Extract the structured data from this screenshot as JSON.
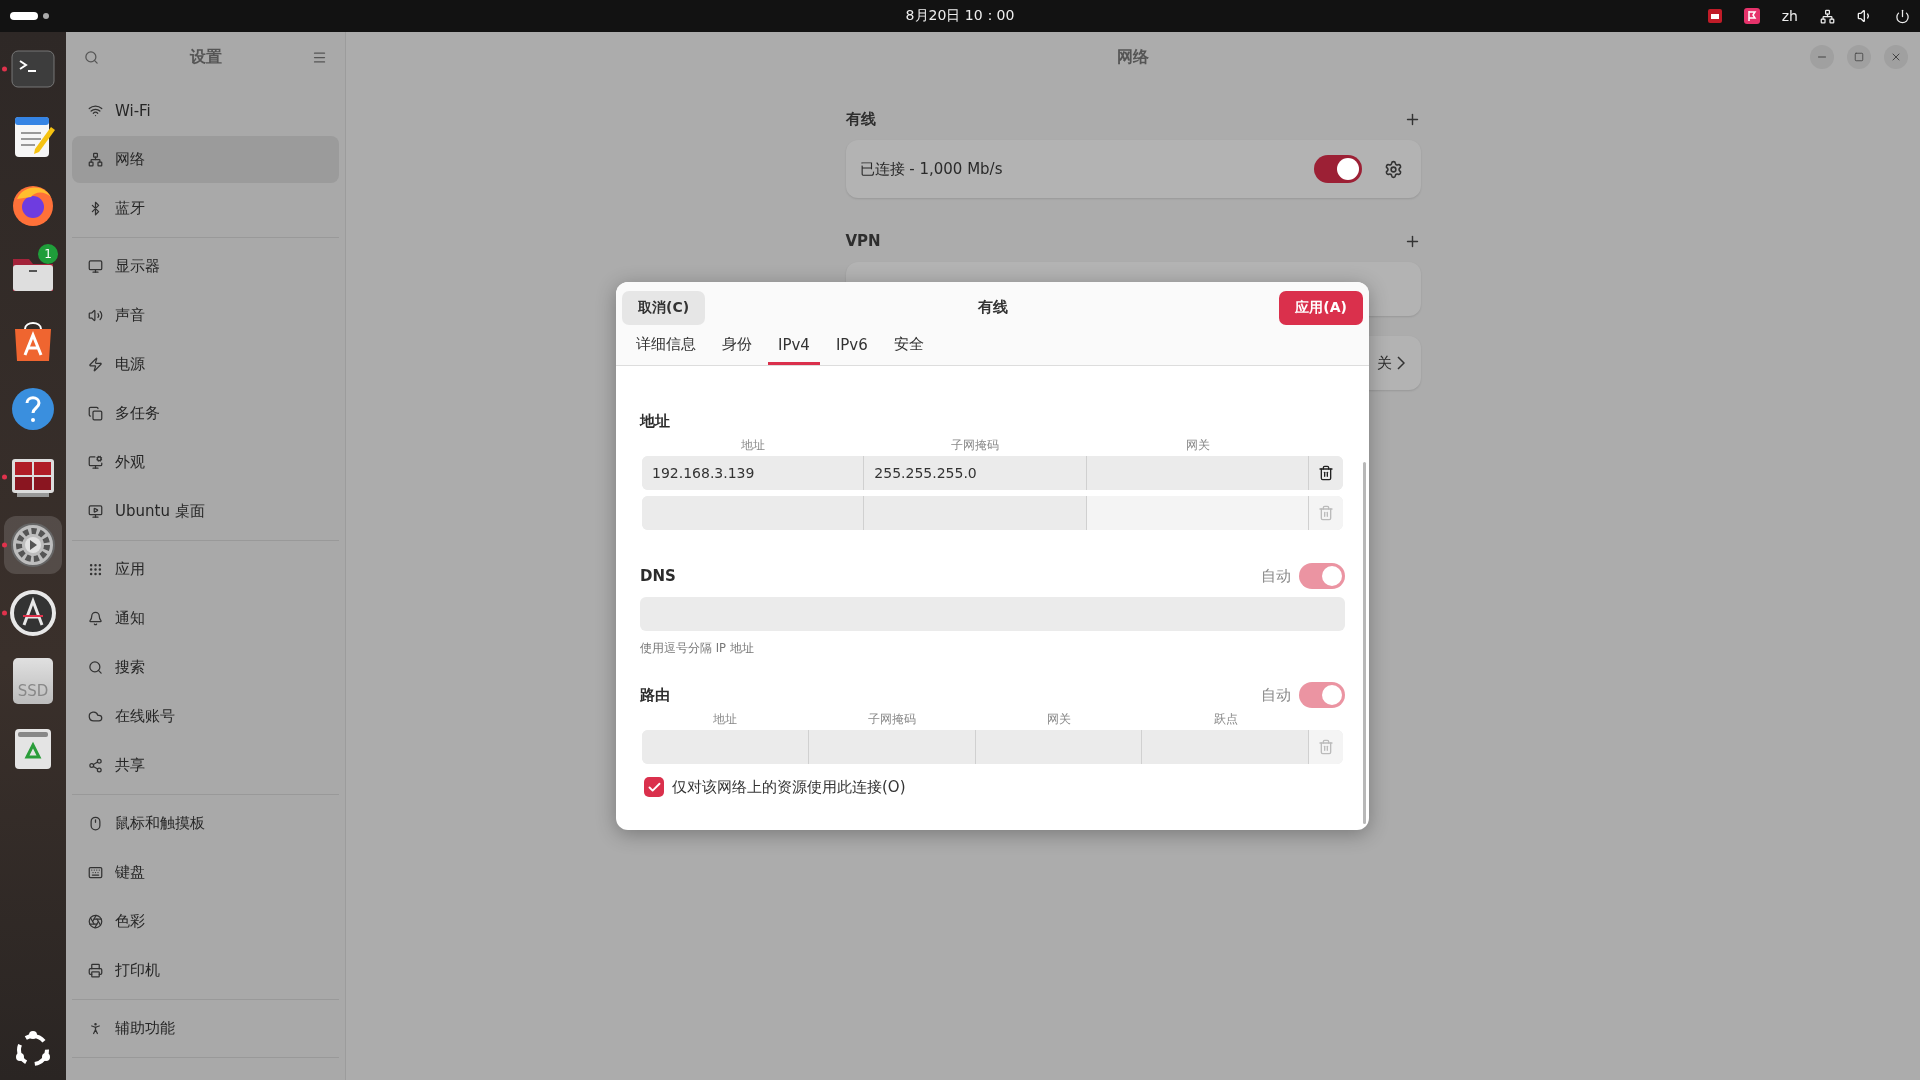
{
  "top_bar": {
    "clock": "8月20日 10：00",
    "input_method": "zh"
  },
  "dock": {
    "items": [
      {
        "kind": "terminal",
        "running": true,
        "selected": false
      },
      {
        "kind": "editor",
        "running": false,
        "selected": false
      },
      {
        "kind": "browser",
        "running": false,
        "selected": false
      },
      {
        "kind": "files",
        "running": false,
        "selected": false,
        "badge": "1"
      },
      {
        "kind": "store",
        "running": false,
        "selected": false
      },
      {
        "kind": "help",
        "running": false,
        "selected": false
      },
      {
        "kind": "grid",
        "running": true,
        "selected": false
      },
      {
        "kind": "settings",
        "running": true,
        "selected": true
      },
      {
        "kind": "updater",
        "running": true,
        "selected": false
      },
      {
        "kind": "drive",
        "running": false,
        "selected": false,
        "label": "SSD"
      },
      {
        "kind": "trash",
        "running": false,
        "selected": false
      }
    ]
  },
  "sidebar": {
    "title": "设置",
    "groups": [
      {
        "items": [
          {
            "label": "Wi-Fi",
            "kind": "wifi",
            "selected": false
          },
          {
            "label": "网络",
            "kind": "network",
            "selected": true
          },
          {
            "label": "蓝牙",
            "kind": "bluetooth",
            "selected": false
          }
        ]
      },
      {
        "items": [
          {
            "label": "显示器",
            "kind": "display",
            "selected": false
          },
          {
            "label": "声音",
            "kind": "sound",
            "selected": false
          },
          {
            "label": "电源",
            "kind": "power",
            "selected": false
          },
          {
            "label": "多任务",
            "kind": "multitask",
            "selected": false
          },
          {
            "label": "外观",
            "kind": "appearance",
            "selected": false
          },
          {
            "label": "Ubuntu 桌面",
            "kind": "desktop",
            "selected": false
          }
        ]
      },
      {
        "items": [
          {
            "label": "应用",
            "kind": "apps",
            "selected": false
          },
          {
            "label": "通知",
            "kind": "bell",
            "selected": false
          },
          {
            "label": "搜索",
            "kind": "search",
            "selected": false
          },
          {
            "label": "在线账号",
            "kind": "cloud",
            "selected": false
          },
          {
            "label": "共享",
            "kind": "share",
            "selected": false
          }
        ]
      },
      {
        "items": [
          {
            "label": "鼠标和触摸板",
            "kind": "mouse",
            "selected": false
          },
          {
            "label": "键盘",
            "kind": "keyboard",
            "selected": false
          },
          {
            "label": "色彩",
            "kind": "color",
            "selected": false
          },
          {
            "label": "打印机",
            "kind": "printer",
            "selected": false
          }
        ]
      },
      {
        "items": [
          {
            "label": "辅助功能",
            "kind": "access",
            "selected": false
          }
        ]
      }
    ]
  },
  "main": {
    "title": "网络",
    "wired": {
      "title": "有线",
      "status": "已连接 - 1,000 Mb/s",
      "on": true
    },
    "vpn": {
      "title": "VPN"
    },
    "proxy": {
      "text": "关"
    }
  },
  "dialog": {
    "cancel": "取消(C)",
    "title": "有线",
    "apply": "应用(A)",
    "tabs": [
      {
        "label": "详细信息",
        "selected": false
      },
      {
        "label": "身份",
        "selected": false
      },
      {
        "label": "IPv4",
        "selected": true
      },
      {
        "label": "IPv6",
        "selected": false
      },
      {
        "label": "安全",
        "selected": false
      }
    ],
    "address": {
      "title": "地址",
      "columns": [
        "地址",
        "子网掩码",
        "网关"
      ],
      "rows": [
        {
          "address": "192.168.3.139",
          "netmask": "255.255.255.0",
          "delete_enabled": true
        },
        {
          "delete_enabled": false
        }
      ]
    },
    "dns": {
      "title": "DNS",
      "auto_label": "自动",
      "auto": true,
      "hint": "使用逗号分隔 IP 地址"
    },
    "routes": {
      "title": "路由",
      "auto_label": "自动",
      "auto": true,
      "columns": [
        "地址",
        "子网掩码",
        "网关",
        "跃点"
      ]
    },
    "only_local": {
      "label": "仅对该网络上的资源使用此连接(O)",
      "checked": true
    }
  }
}
